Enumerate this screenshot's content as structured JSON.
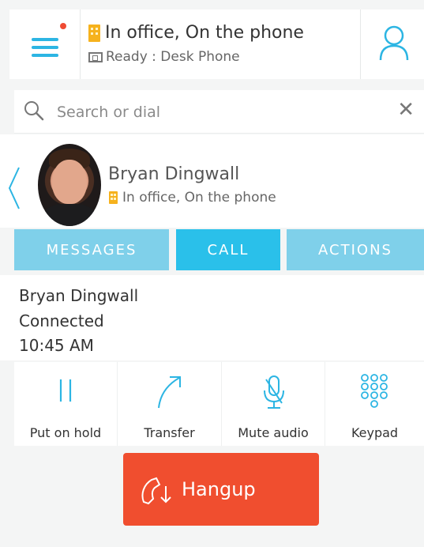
{
  "header": {
    "presence": "In office, On the phone",
    "device_status": "Ready : Desk Phone",
    "notification_color": "#ef4b33",
    "presence_icon": "building-icon",
    "device_icon": "desk-phone-icon"
  },
  "search": {
    "placeholder": "Search or dial",
    "clear_icon": "close-icon"
  },
  "contact": {
    "name": "Bryan Dingwall",
    "presence": "In office, On the phone"
  },
  "tabs": [
    {
      "label": "MESSAGES",
      "active": false
    },
    {
      "label": "CALL",
      "active": true
    },
    {
      "label": "ACTIONS",
      "active": false
    }
  ],
  "call": {
    "name": "Bryan Dingwall",
    "state": "Connected",
    "time": "10:45 AM"
  },
  "actions": [
    {
      "label": "Put on hold",
      "icon": "pause-icon"
    },
    {
      "label": "Transfer",
      "icon": "transfer-icon"
    },
    {
      "label": "Mute audio",
      "icon": "microphone-mute-icon"
    },
    {
      "label": "Keypad",
      "icon": "keypad-icon"
    }
  ],
  "hangup": {
    "label": "Hangup",
    "color": "#f04e2f",
    "icon": "hangup-phone-icon"
  },
  "colors": {
    "accent": "#2ac0ea",
    "tab_inactive": "#7fd0ea",
    "icon_blue": "#2cb5e3"
  }
}
